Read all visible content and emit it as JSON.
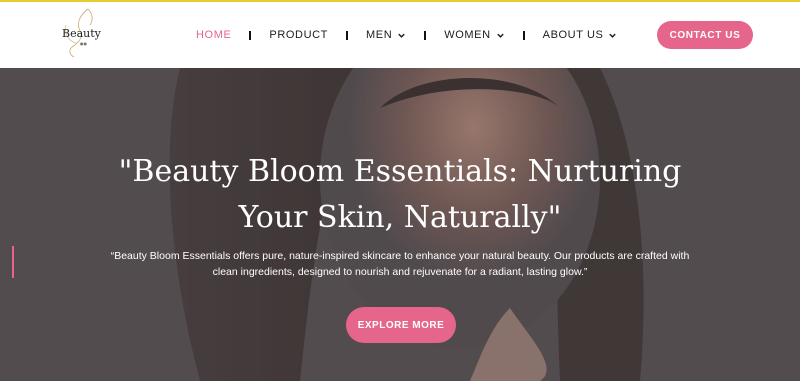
{
  "brand": {
    "logo_text": "Beauty",
    "accent": "#e5668a",
    "topline": "#e6cd2d"
  },
  "nav": {
    "items": [
      {
        "label": "HOME",
        "active": true,
        "dropdown": false
      },
      {
        "label": "PRODUCT",
        "active": false,
        "dropdown": false
      },
      {
        "label": "MEN",
        "active": false,
        "dropdown": true
      },
      {
        "label": "WOMEN",
        "active": false,
        "dropdown": true
      },
      {
        "label": "ABOUT US",
        "active": false,
        "dropdown": true
      }
    ]
  },
  "header": {
    "contact_label": "CONTACT US"
  },
  "hero": {
    "title": "\"Beauty Bloom Essentials: Nurturing Your Skin, Naturally\"",
    "subtitle": "“Beauty Bloom Essentials offers pure, nature-inspired skincare to enhance your natural beauty. Our products are crafted with clean ingredients, designed to nourish and rejuvenate for a radiant, lasting glow.”",
    "cta_label": "EXPLORE MORE"
  }
}
